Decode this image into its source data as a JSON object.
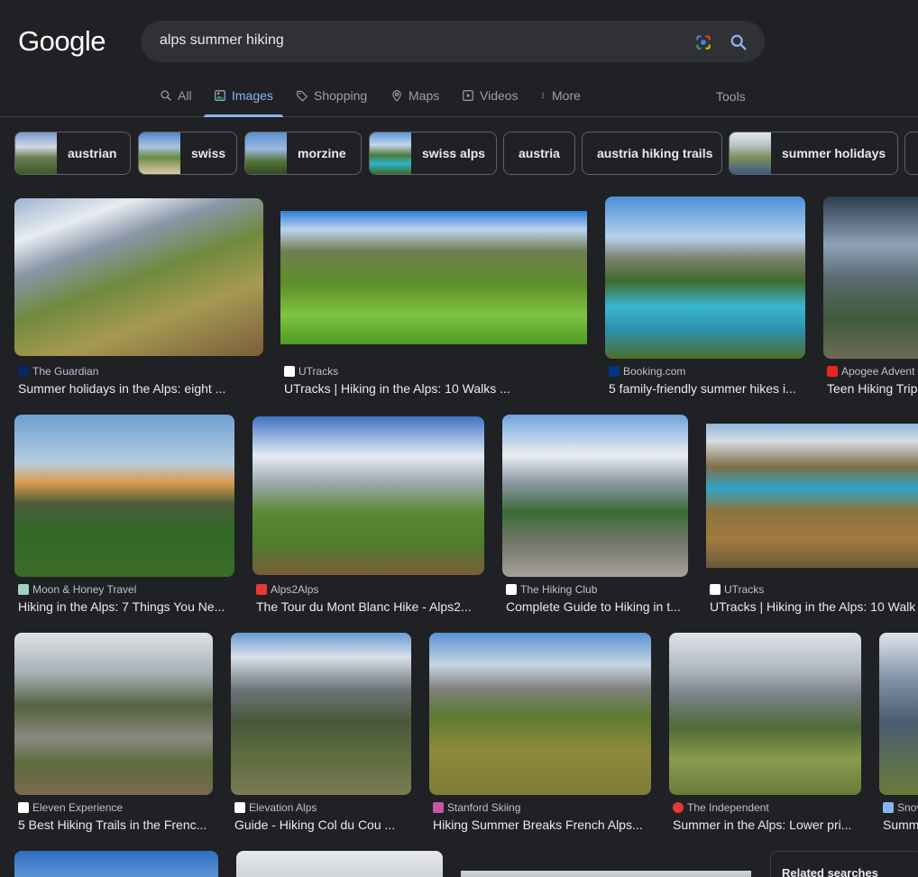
{
  "logo": "Google",
  "search": {
    "query": "alps summer hiking"
  },
  "tabs": [
    {
      "label": "All"
    },
    {
      "label": "Images"
    },
    {
      "label": "Shopping"
    },
    {
      "label": "Maps"
    },
    {
      "label": "Videos"
    },
    {
      "label": "More"
    }
  ],
  "tools_label": "Tools",
  "chips": [
    {
      "label": "austrian"
    },
    {
      "label": "swiss"
    },
    {
      "label": "morzine"
    },
    {
      "label": "swiss alps"
    },
    {
      "label": "austria"
    },
    {
      "label": "austria hiking trails"
    },
    {
      "label": "summer holidays"
    }
  ],
  "results": [
    {
      "source": "The Guardian",
      "title": "Summer holidays in the Alps: eight ..."
    },
    {
      "source": "UTracks",
      "title": "UTracks | Hiking in the Alps: 10 Walks ..."
    },
    {
      "source": "Booking.com",
      "title": "5 family-friendly summer hikes i..."
    },
    {
      "source": "Apogee Advent",
      "title": "Teen Hiking Trip"
    },
    {
      "source": "Moon & Honey Travel",
      "title": "Hiking in the Alps: 7 Things You Ne..."
    },
    {
      "source": "Alps2Alps",
      "title": "The Tour du Mont Blanc Hike - Alps2..."
    },
    {
      "source": "The Hiking Club",
      "title": "Complete Guide to Hiking in t..."
    },
    {
      "source": "UTracks",
      "title": "UTracks | Hiking in the Alps: 10 Walk"
    },
    {
      "source": "Eleven Experience",
      "title": "5 Best Hiking Trails in the Frenc..."
    },
    {
      "source": "Elevation Alps",
      "title": "Guide - Hiking Col du Cou ..."
    },
    {
      "source": "Stanford Skiing",
      "title": "Hiking Summer Breaks French Alps..."
    },
    {
      "source": "The Independent",
      "title": "Summer in the Alps: Lower pri..."
    },
    {
      "source": "Snov",
      "title": "Summ"
    }
  ],
  "related_label": "Related searches"
}
